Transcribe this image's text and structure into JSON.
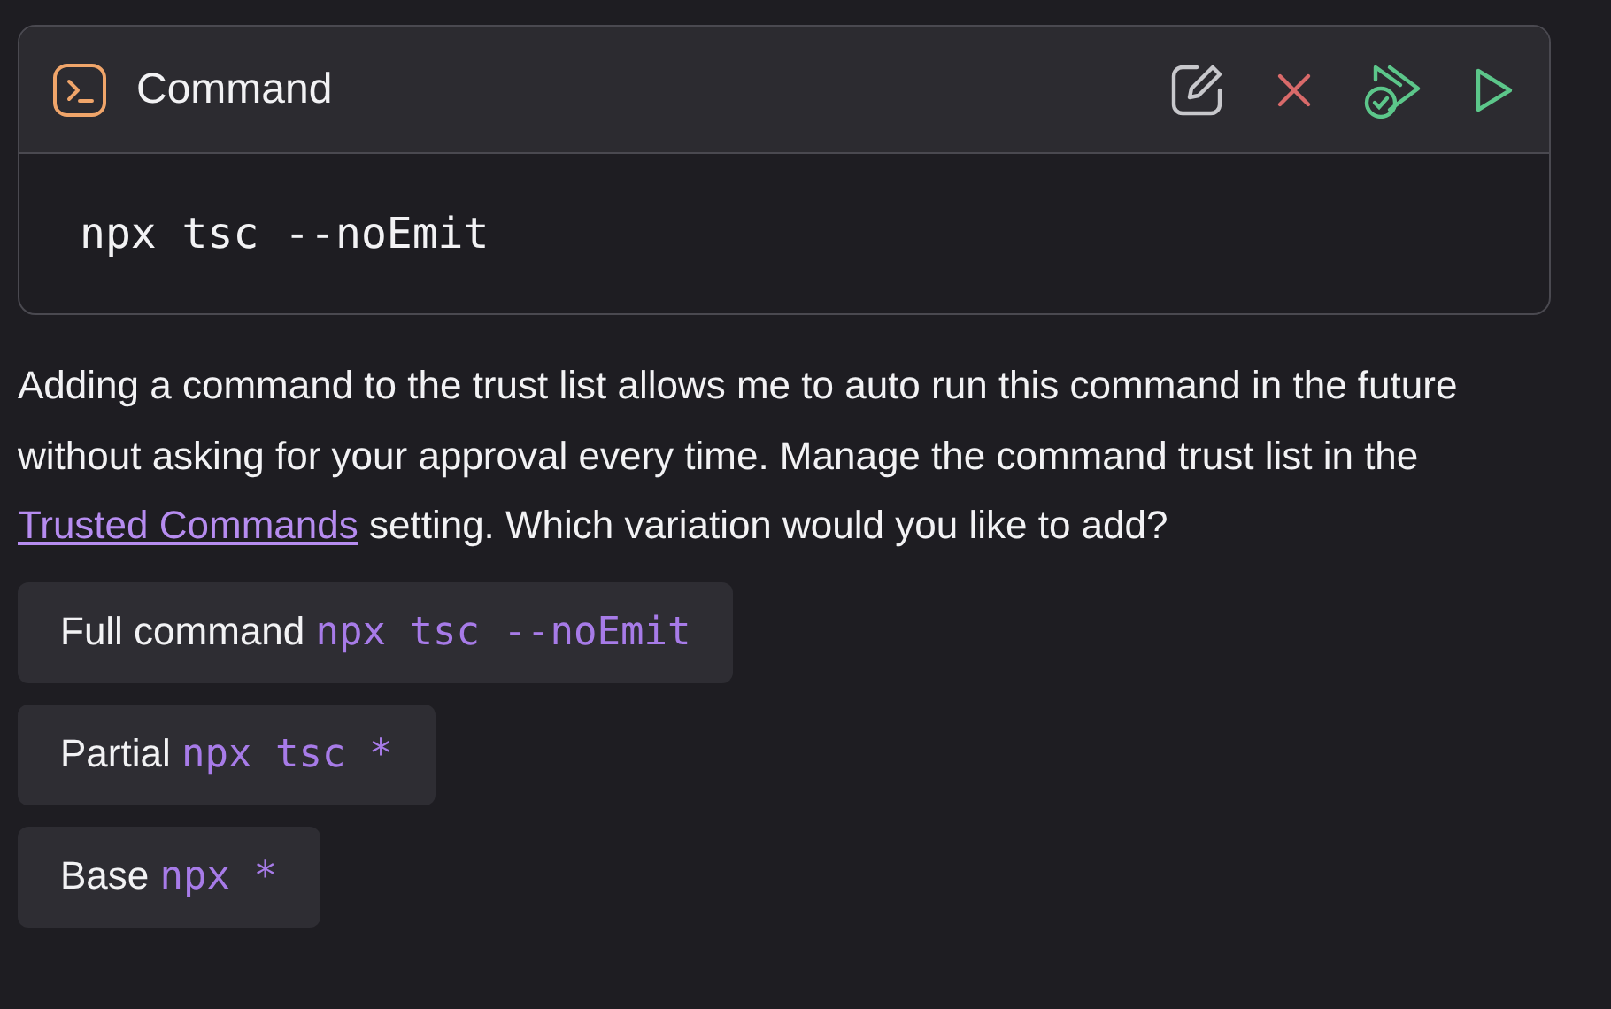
{
  "command_card": {
    "title": "Command",
    "command": "npx tsc --noEmit"
  },
  "message": {
    "before": "Adding a command to the trust list allows me to auto run this command in the future without asking for your approval every time. Manage the command trust list in the ",
    "link": "Trusted Commands",
    "after": " setting. Which variation would you like to add?"
  },
  "options": [
    {
      "label": "Full command",
      "pattern": "npx tsc --noEmit"
    },
    {
      "label": "Partial",
      "pattern": "npx tsc *"
    },
    {
      "label": "Base",
      "pattern": "npx *"
    }
  ]
}
